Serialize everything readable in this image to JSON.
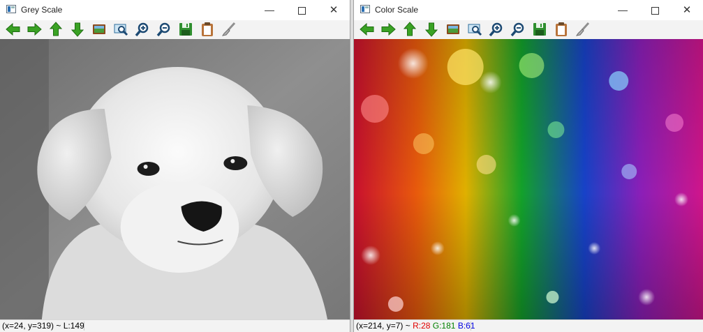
{
  "windows": [
    {
      "title": "Grey Scale",
      "status": {
        "coords": "(x=24, y=319) ~",
        "luma": "L:149"
      }
    },
    {
      "title": "Color Scale",
      "status": {
        "coords": "(x=214, y=7) ~",
        "red": "R:28",
        "green": "G:181",
        "blue": "B:61"
      }
    }
  ],
  "caption_buttons": {
    "minimize": "—",
    "close": "✕"
  },
  "toolbar_icons": [
    "arrow-left-icon",
    "arrow-right-icon",
    "arrow-up-icon",
    "arrow-down-icon",
    "image-icon",
    "zoom-fit-icon",
    "zoom-in-icon",
    "zoom-out-icon",
    "save-icon",
    "clipboard-icon",
    "brush-icon"
  ],
  "colors": {
    "status_red": "#e00000",
    "status_green": "#008000",
    "status_blue": "#0000e0",
    "arrow_green": "#3aa224"
  }
}
